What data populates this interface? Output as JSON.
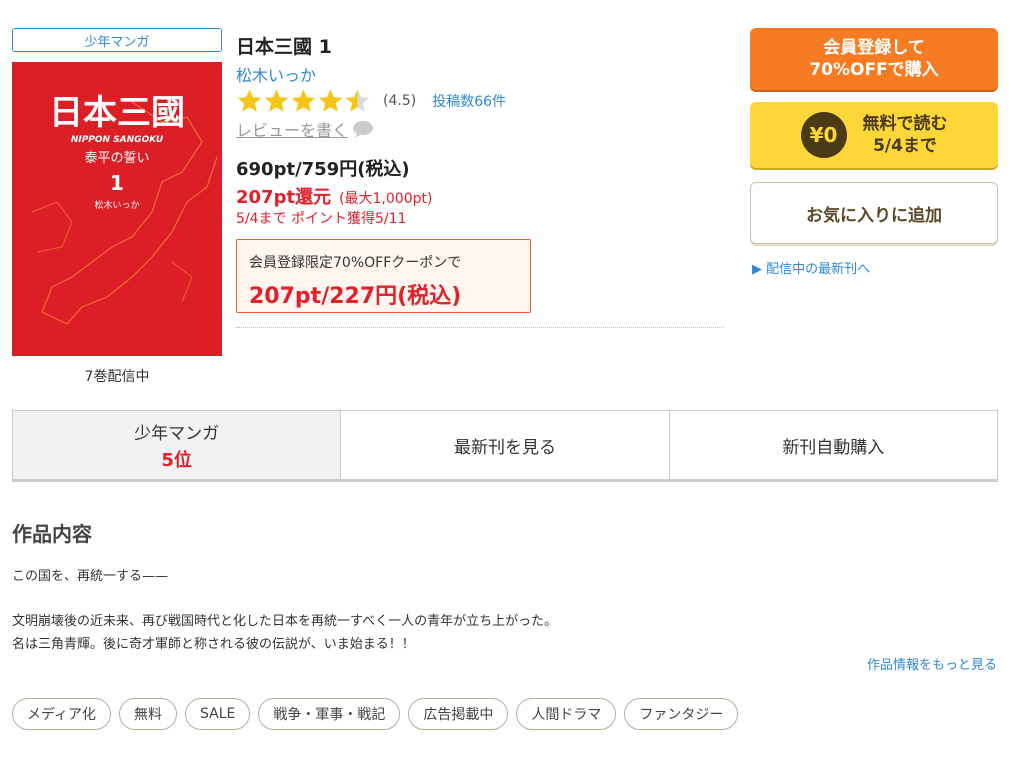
{
  "product": {
    "genre": "少年マンガ",
    "cover_title": "日本三國",
    "cover_subtitle": "泰平の誓い",
    "cover_volume": "1",
    "cover_author": "松木いっか",
    "cover_romaji": "NIPPON SANGOKU",
    "volume_status": "7巻配信中",
    "title": "日本三國 1",
    "author": "松木いっか",
    "rating": 4.5,
    "rating_text": "(4.5)",
    "review_count": "投稿数66件",
    "write_review": "レビューを書く",
    "price": "690pt/759円(税込)",
    "points_back": "207pt還元",
    "points_max": "(最大1,000pt)",
    "points_deadline": "5/4まで ポイント獲得5/11",
    "coupon_label": "会員登録限定70%OFFクーポンで",
    "coupon_price": "207pt/227円(税込)"
  },
  "actions": {
    "member_line1": "会員登録して",
    "member_line2": "70%OFFで購入",
    "free_icon": "¥0",
    "free_line1": "無料で読む",
    "free_line2": "5/4まで",
    "favorite": "お気に入りに追加",
    "latest_link": "▶ 配信中の最新刊へ"
  },
  "tabs": {
    "rank_genre": "少年マンガ",
    "rank_value": "5位",
    "latest": "最新刊を見る",
    "auto_buy": "新刊自動購入"
  },
  "synopsis": {
    "heading": "作品内容",
    "line1": "この国を、再統一する——",
    "line2": "文明崩壊後の近未来、再び戦国時代と化した日本を再統一すべく一人の青年が立ち上がった。",
    "line3": "名は三角青輝。後に奇才軍師と称される彼の伝説が、いま始まる！！",
    "more": "作品情報をもっと見る"
  },
  "tags": [
    "メディア化",
    "無料",
    "SALE",
    "戦争・軍事・戦記",
    "広告掲載中",
    "人間ドラマ",
    "ファンタジー"
  ],
  "colors": {
    "accent_blue": "#2f88d6",
    "price_red": "#e0202b",
    "member_orange": "#f77b22",
    "free_yellow": "#fcd737",
    "cover_red": "#dc1f27",
    "star_yellow": "#f5c518"
  }
}
